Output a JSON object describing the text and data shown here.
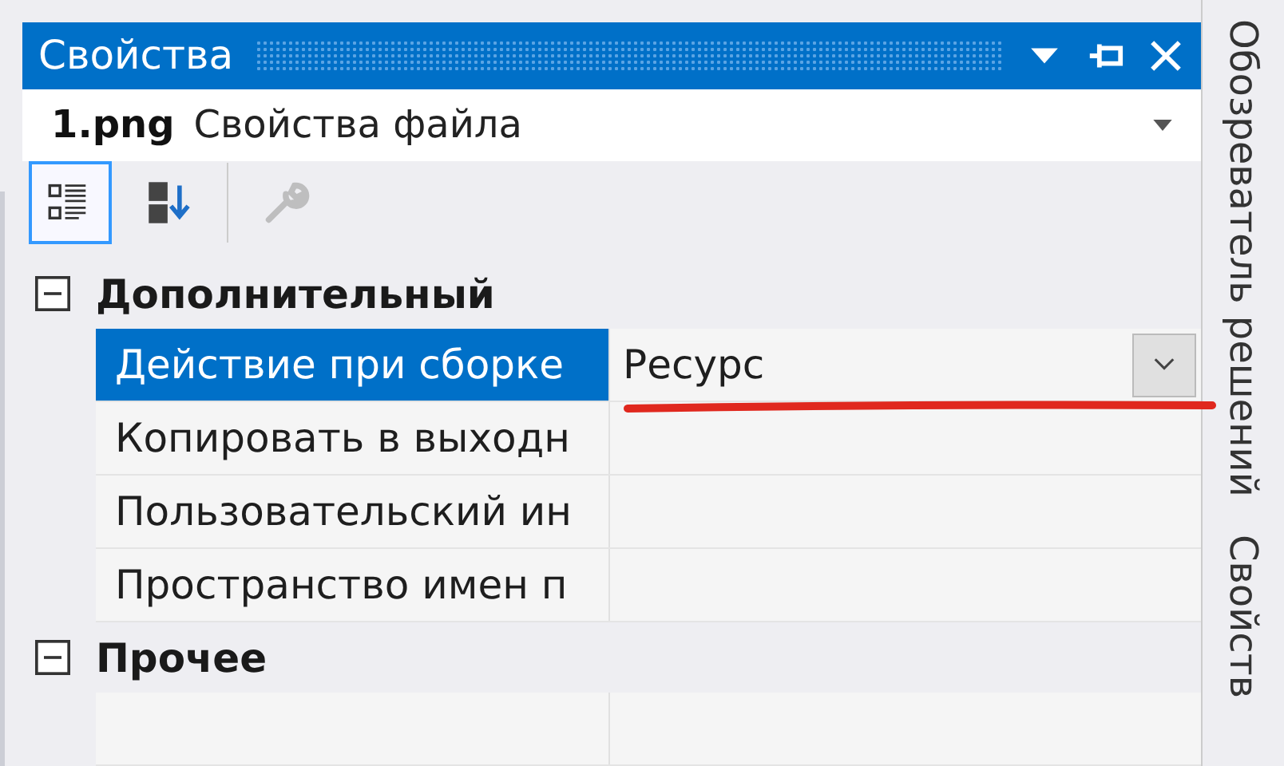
{
  "panel": {
    "title": "Свойства"
  },
  "object_selector": {
    "name": "1.png",
    "type": "Свойства файла"
  },
  "toolbar": [
    {
      "kind": "categorized",
      "selected": true,
      "disabled": false
    },
    {
      "kind": "alphabetical",
      "selected": false,
      "disabled": false
    },
    {
      "kind": "property-pages",
      "selected": false,
      "disabled": true
    }
  ],
  "categories": [
    {
      "name": "Дополнительный",
      "expanded": true,
      "rows": [
        {
          "name": "Действие при сборке",
          "value": "Ресурс",
          "selected": true,
          "dropdown": true
        },
        {
          "name": "Копировать в выходн",
          "value": "",
          "selected": false,
          "dropdown": false
        },
        {
          "name": "Пользовательский ин",
          "value": "",
          "selected": false,
          "dropdown": false
        },
        {
          "name": "Пространство имен п",
          "value": "",
          "selected": false,
          "dropdown": false
        }
      ]
    },
    {
      "name": "Прочее",
      "expanded": true,
      "rows": [
        {
          "name": "",
          "value": "",
          "selected": false,
          "dropdown": false
        }
      ]
    }
  ],
  "side_tabs": [
    {
      "label": "Обозреватель решений"
    },
    {
      "label": "Свойств"
    }
  ]
}
